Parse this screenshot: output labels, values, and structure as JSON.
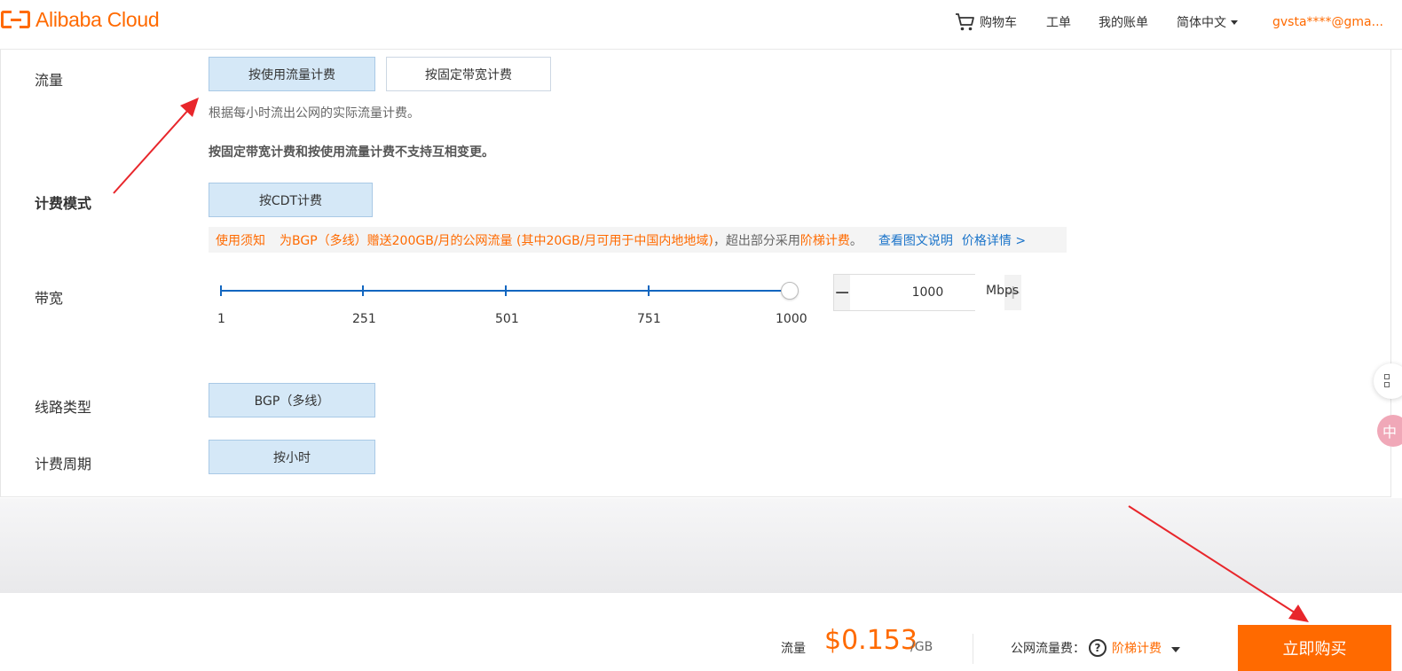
{
  "header": {
    "logo_text": "Alibaba Cloud",
    "cart": "购物车",
    "ticket": "工单",
    "bill": "我的账单",
    "language": "简体中文",
    "user": "gvsta****@gma..."
  },
  "form": {
    "traffic": {
      "label": "流量",
      "options": [
        "按使用流量计费",
        "按固定带宽计费"
      ],
      "selected": "按使用流量计费",
      "hint": "根据每小时流出公网的实际流量计费。",
      "warning": "按固定带宽计费和按使用流量计费不支持互相变更。"
    },
    "billing_mode": {
      "label": "计费模式",
      "option": "按CDT计费",
      "notice": {
        "tag": "使用须知",
        "text1": "为BGP（多线）赠送200GB/月的公网流量 (其中20GB/月可用于中国内地地域)",
        "text2": "，超出部分采用",
        "text3": "阶梯计费",
        "text4": "。",
        "link1": "查看图文说明",
        "link2": "价格详情 >"
      }
    },
    "bandwidth": {
      "label": "带宽",
      "ticks": [
        "1",
        "251",
        "501",
        "751",
        "1000"
      ],
      "value": "1000",
      "fraction": 1.0,
      "unit": "Mbps",
      "minus": "−",
      "plus": "+"
    },
    "line_type": {
      "label": "线路类型",
      "option": "BGP（多线）"
    },
    "billing_cycle": {
      "label": "计费周期",
      "option": "按小时"
    }
  },
  "footer": {
    "traffic_label": "流量",
    "price": "$0.153",
    "per_unit": "/GB",
    "fee_label": "公网流量费：",
    "help_icon": "?",
    "tier": "阶梯计费",
    "buy": "立即购买"
  },
  "floats": {
    "b_glyph": "中"
  },
  "colors": {
    "accent": "#ff6a00",
    "selected_bg": "#d5e8f7",
    "link": "#1a73c9",
    "slider": "#1166c0",
    "annotation": "#e8262b"
  }
}
